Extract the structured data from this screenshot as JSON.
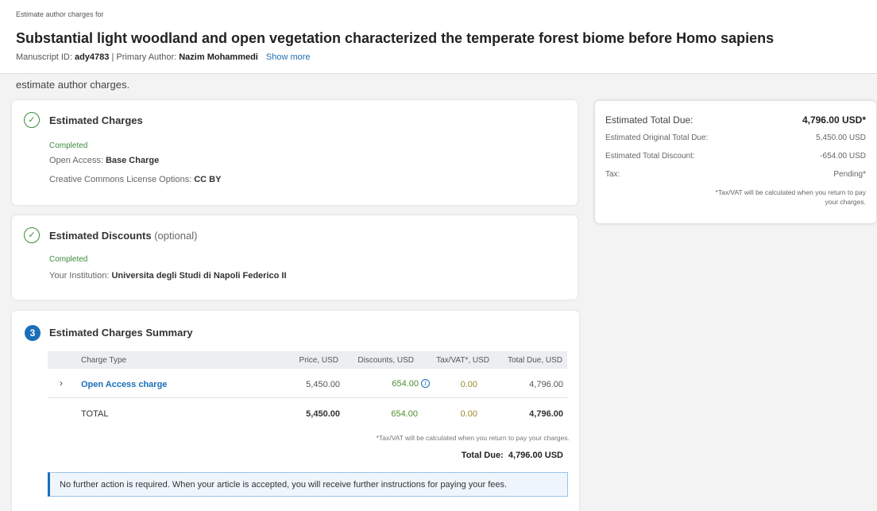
{
  "header": {
    "eyebrow": "Estimate author charges for",
    "title": "Substantial light woodland and open vegetation characterized the temperate forest biome before Homo sapiens",
    "manuscript_label": "Manuscript ID: ",
    "manuscript_id": "ady4783",
    "separator": " | Primary Author: ",
    "author": "Nazim Mohammedi",
    "show_more": "Show more"
  },
  "intro": "estimate author charges.",
  "charges": {
    "title": "Estimated Charges",
    "status": "Completed",
    "open_access_label": "Open Access: ",
    "open_access_value": "Base Charge",
    "license_label": "Creative Commons License Options: ",
    "license_value": "CC BY"
  },
  "discounts": {
    "title": "Estimated Discounts",
    "title_suffix": "(optional)",
    "status": "Completed",
    "institution_label": "Your Institution: ",
    "institution_value": "Universita degli Studi di Napoli Federico II"
  },
  "summary_table": {
    "step": "3",
    "title": "Estimated Charges Summary",
    "columns": [
      "Charge Type",
      "Price, USD",
      "Discounts, USD",
      "Tax/VAT*, USD",
      "Total Due, USD"
    ],
    "rows": [
      {
        "charge_type": "Open Access charge",
        "price": "5,450.00",
        "discount": "654.00",
        "tax": "0.00",
        "total": "4,796.00"
      }
    ],
    "total_row": {
      "label": "TOTAL",
      "price": "5,450.00",
      "discount": "654.00",
      "tax": "0.00",
      "total": "4,796.00"
    },
    "tax_note": "*Tax/VAT will be calculated when you return to pay your charges.",
    "total_due_label": "Total Due:",
    "total_due_value": "4,796.00 USD",
    "notice": "No further action is required. When your article is accepted, you will receive further instructions for paying your fees."
  },
  "summary_box": {
    "total_due_label": "Estimated Total Due:",
    "total_due_value": "4,796.00 USD*",
    "original_label": "Estimated Original Total Due:",
    "original_value": "5,450.00 USD",
    "discount_label": "Estimated Total Discount:",
    "discount_value": "-654.00 USD",
    "tax_label": "Tax:",
    "tax_value": "Pending*",
    "note": "*Tax/VAT will be calculated when you return to pay your charges."
  },
  "colors": {
    "accent": "#1a6fb8",
    "success": "#3d8b3d",
    "discount_green": "#4e8f2f",
    "tax_olive": "#9a8a2e"
  }
}
